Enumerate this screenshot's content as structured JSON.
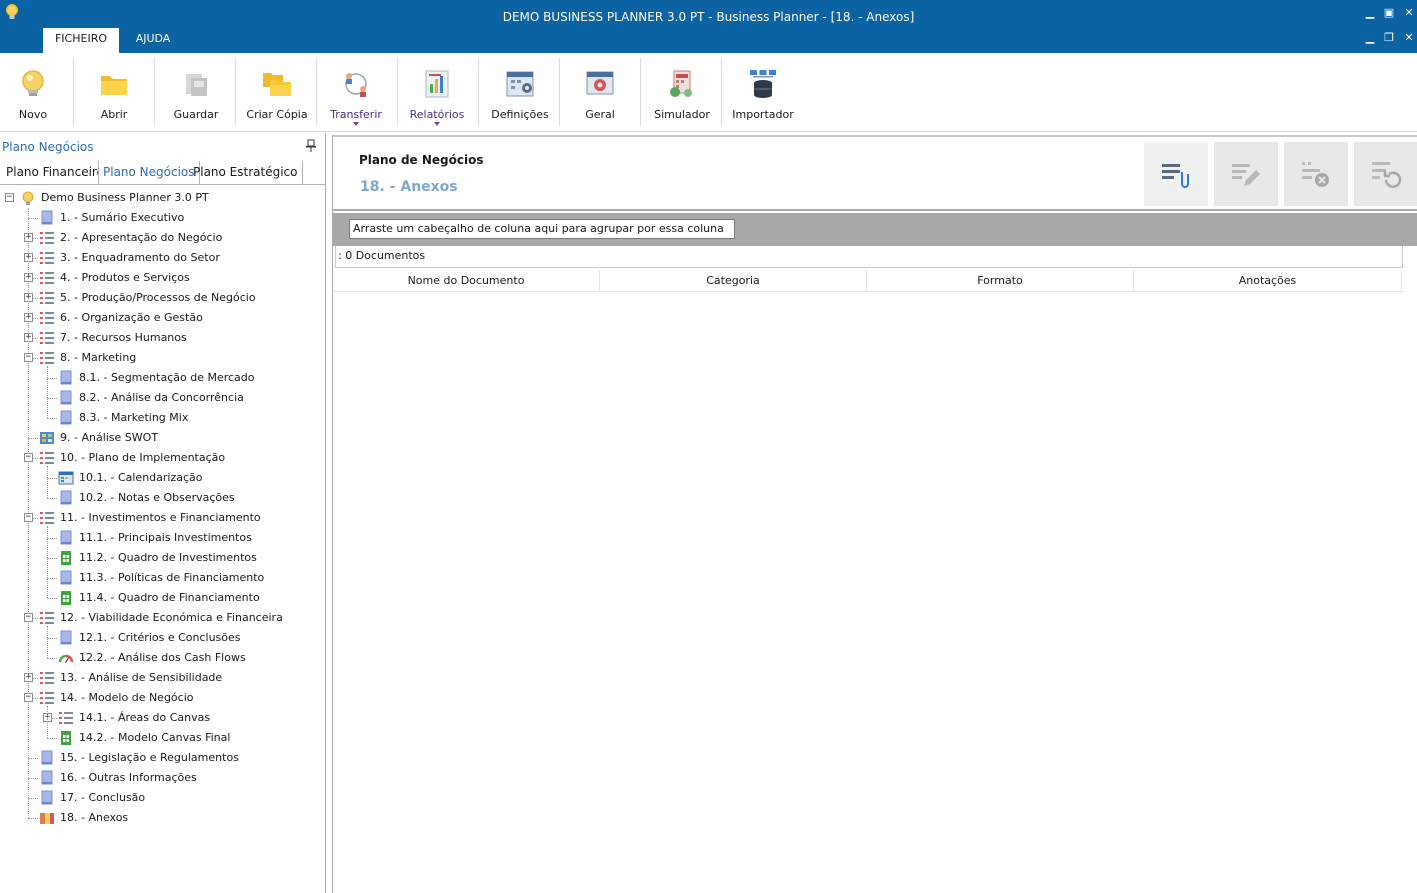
{
  "window": {
    "title": "DEMO BUSINESS PLANNER 3.0 PT - Business Planner - [18. - Anexos]",
    "controls": {
      "minimize": "▁",
      "maximize": "▣",
      "close": "✕",
      "child_minimize": "▁",
      "child_restore": "❐",
      "child_close": "✕"
    }
  },
  "menu": {
    "tabs": [
      {
        "label": "FICHEIRO",
        "active": true
      },
      {
        "label": "AJUDA",
        "active": false
      }
    ]
  },
  "ribbon": {
    "buttons": [
      {
        "label": "Novo",
        "icon": "lightbulb-icon"
      },
      {
        "label": "Abrir",
        "icon": "folder-icon"
      },
      {
        "label": "Guardar",
        "icon": "save-icon"
      },
      {
        "label": "Criar Cópia",
        "icon": "copy-folder-icon"
      },
      {
        "label": "Transferir",
        "icon": "transfer-icon",
        "dropdown": true
      },
      {
        "label": "Relatórios",
        "icon": "reports-icon",
        "dropdown": true
      },
      {
        "label": "Definições",
        "icon": "settings-calendar-icon"
      },
      {
        "label": "Geral",
        "icon": "general-gear-icon"
      },
      {
        "label": "Simulador",
        "icon": "simulator-icon"
      },
      {
        "label": "Importador",
        "icon": "importer-icon"
      }
    ]
  },
  "left_panel": {
    "title": "Plano Negócios",
    "tabs": [
      {
        "label": "Plano Financeiro",
        "active": false
      },
      {
        "label": "Plano Negócios",
        "active": true
      },
      {
        "label": "Plano Estratégico",
        "active": false
      }
    ],
    "tree": [
      {
        "label": "Demo Business Planner 3.0 PT",
        "level": 0,
        "expander": "−",
        "icon": "lightbulb-icon"
      },
      {
        "label": "1. - Sumário Executivo",
        "level": 1,
        "expander": "",
        "icon": "document-icon"
      },
      {
        "label": "2. - Apresentação do Negócio",
        "level": 1,
        "expander": "+",
        "icon": "list-icon"
      },
      {
        "label": "3. - Enquadramento do Setor",
        "level": 1,
        "expander": "+",
        "icon": "list-icon"
      },
      {
        "label": "4. - Produtos e Serviços",
        "level": 1,
        "expander": "+",
        "icon": "list-icon"
      },
      {
        "label": "5. - Produção/Processos de Negócio",
        "level": 1,
        "expander": "+",
        "icon": "list-icon"
      },
      {
        "label": "6. - Organização e Gestão",
        "level": 1,
        "expander": "+",
        "icon": "list-icon"
      },
      {
        "label": "7. - Recursos Humanos",
        "level": 1,
        "expander": "+",
        "icon": "list-icon"
      },
      {
        "label": "8. - Marketing",
        "level": 1,
        "expander": "−",
        "icon": "list-icon"
      },
      {
        "label": "8.1. - Segmentação de Mercado",
        "level": 2,
        "expander": "",
        "icon": "document-icon"
      },
      {
        "label": "8.2. - Análise da Concorrência",
        "level": 2,
        "expander": "",
        "icon": "document-icon"
      },
      {
        "label": "8.3. - Marketing Mix",
        "level": 2,
        "expander": "",
        "icon": "document-icon"
      },
      {
        "label": "9. - Análise SWOT",
        "level": 1,
        "expander": "",
        "icon": "swot-icon"
      },
      {
        "label": "10. - Plano de Implementação",
        "level": 1,
        "expander": "−",
        "icon": "list-icon"
      },
      {
        "label": "10.1. - Calendarização",
        "level": 2,
        "expander": "",
        "icon": "calendar-icon"
      },
      {
        "label": "10.2. - Notas e Observações",
        "level": 2,
        "expander": "",
        "icon": "document-icon"
      },
      {
        "label": "11. - Investimentos e Financiamento",
        "level": 1,
        "expander": "−",
        "icon": "list-icon"
      },
      {
        "label": "11.1. - Principais Investimentos",
        "level": 2,
        "expander": "",
        "icon": "document-icon"
      },
      {
        "label": "11.2. - Quadro de Investimentos",
        "level": 2,
        "expander": "",
        "icon": "spreadsheet-icon"
      },
      {
        "label": "11.3. - Políticas de Financiamento",
        "level": 2,
        "expander": "",
        "icon": "document-icon"
      },
      {
        "label": "11.4. - Quadro de Financiamento",
        "level": 2,
        "expander": "",
        "icon": "spreadsheet-icon"
      },
      {
        "label": "12. - Viabilidade Económica e Financeira",
        "level": 1,
        "expander": "−",
        "icon": "list-icon"
      },
      {
        "label": "12.1. - Critérios e Conclusões",
        "level": 2,
        "expander": "",
        "icon": "document-icon"
      },
      {
        "label": "12.2. - Análise dos Cash Flows",
        "level": 2,
        "expander": "",
        "icon": "gauge-icon"
      },
      {
        "label": "13. - Análise de Sensibilidade",
        "level": 1,
        "expander": "+",
        "icon": "list-icon"
      },
      {
        "label": "14. - Modelo de Negócio",
        "level": 1,
        "expander": "−",
        "icon": "list-icon"
      },
      {
        "label": "14.1. - Áreas do Canvas",
        "level": 2,
        "expander": "+",
        "icon": "list-icon"
      },
      {
        "label": "14.2. - Modelo Canvas Final",
        "level": 2,
        "expander": "",
        "icon": "spreadsheet-icon"
      },
      {
        "label": "15. - Legislação e Regulamentos",
        "level": 1,
        "expander": "",
        "icon": "document-icon"
      },
      {
        "label": "16. - Outras Informações",
        "level": 1,
        "expander": "",
        "icon": "document-icon"
      },
      {
        "label": "17. - Conclusão",
        "level": 1,
        "expander": "",
        "icon": "document-icon"
      },
      {
        "label": "18. - Anexos",
        "level": 1,
        "expander": "",
        "icon": "attachments-icon"
      }
    ]
  },
  "content": {
    "header_title": "Plano de Negócios",
    "header_subtitle": "18. - Anexos",
    "actions": [
      {
        "name": "attach-document",
        "icon": "attach-icon",
        "enabled": true
      },
      {
        "name": "edit-document",
        "icon": "edit-icon",
        "enabled": false
      },
      {
        "name": "delete-document",
        "icon": "delete-icon",
        "enabled": false
      },
      {
        "name": "undo-document",
        "icon": "undo-icon",
        "enabled": false
      }
    ],
    "group_hint": "Arraste um cabeçalho de coluna aqui para agrupar por essa coluna",
    "doc_count": ": 0 Documentos",
    "columns": [
      "Nome do Documento",
      "Categoria",
      "Formato",
      "Anotações"
    ]
  },
  "colors": {
    "titlebar": "#0c63a4",
    "accent_blue": "#2d6db3",
    "subtitle_blue": "#7ea7cf",
    "group_bar": "#a9a9a9"
  }
}
